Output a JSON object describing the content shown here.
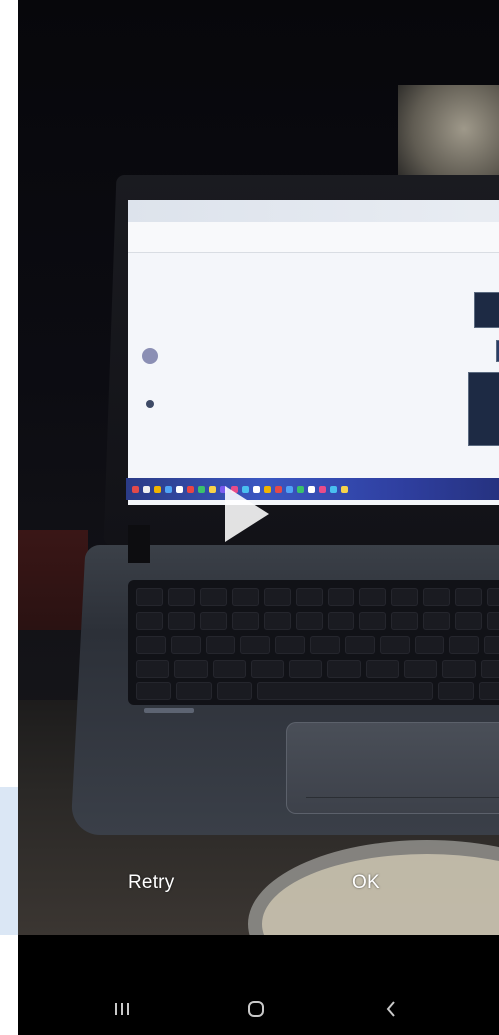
{
  "preview": {
    "play_icon": "play-icon"
  },
  "actions": {
    "retry_label": "Retry",
    "ok_label": "OK"
  },
  "navigation": {
    "recents_icon": "recents-icon",
    "home_icon": "home-icon",
    "back_icon": "back-icon"
  },
  "colors": {
    "background": "#000000",
    "button_text": "#ffffff",
    "nav_icon": "#c9c9c9",
    "side_panel": "#dbe7f5"
  }
}
